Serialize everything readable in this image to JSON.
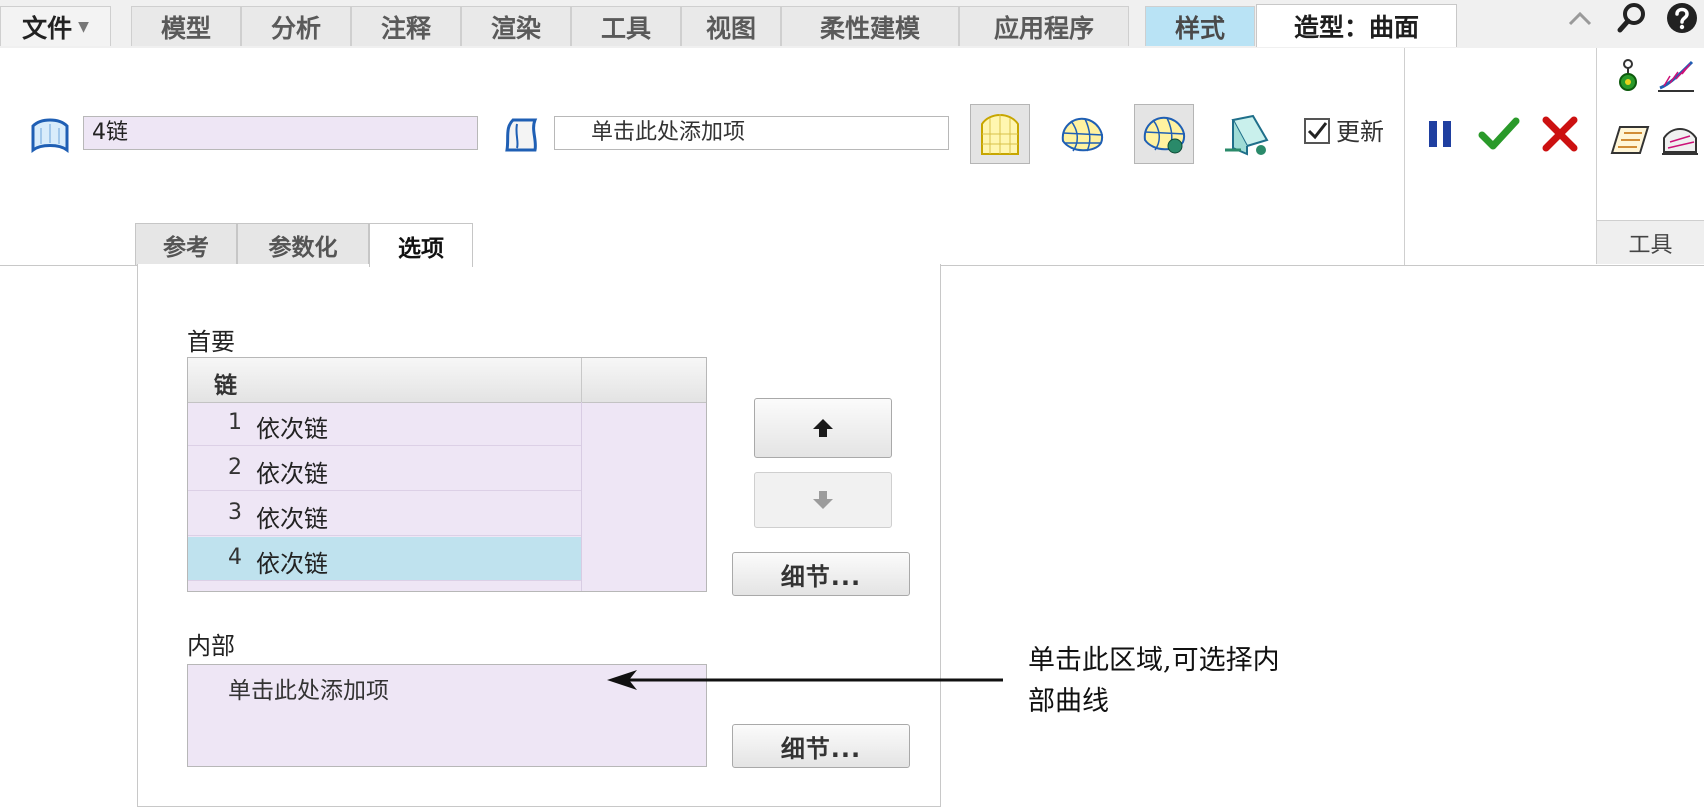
{
  "menu": {
    "file": "文件",
    "tabs": [
      "模型",
      "分析",
      "注释",
      "渲染",
      "工具",
      "视图",
      "柔性建模",
      "应用程序"
    ],
    "style_tab": "样式",
    "active_tab": "造型：曲面"
  },
  "ribbon": {
    "chain_value": "4链",
    "add_placeholder": "单击此处添加项",
    "update_label": "更新",
    "update_checked": true,
    "tools_label": "工具"
  },
  "subtabs": [
    "参考",
    "参数化",
    "选项"
  ],
  "panel": {
    "primary_label": "首要",
    "table_header": "链",
    "rows": [
      {
        "num": "1",
        "text": "依次链"
      },
      {
        "num": "2",
        "text": "依次链"
      },
      {
        "num": "3",
        "text": "依次链"
      },
      {
        "num": "4",
        "text": "依次链"
      }
    ],
    "details_button": "细节...",
    "inner_label": "内部",
    "inner_placeholder": "单击此处添加项"
  },
  "annotation": {
    "line1": "单击此区域,可选择内",
    "line2": "部曲线"
  },
  "colors": {
    "accent_blue": "#1f5fb4",
    "selected_row": "#bfe2ee",
    "field_bg": "#eee6f5",
    "confirm_green": "#2a9a2a",
    "cancel_red": "#cc1111"
  }
}
